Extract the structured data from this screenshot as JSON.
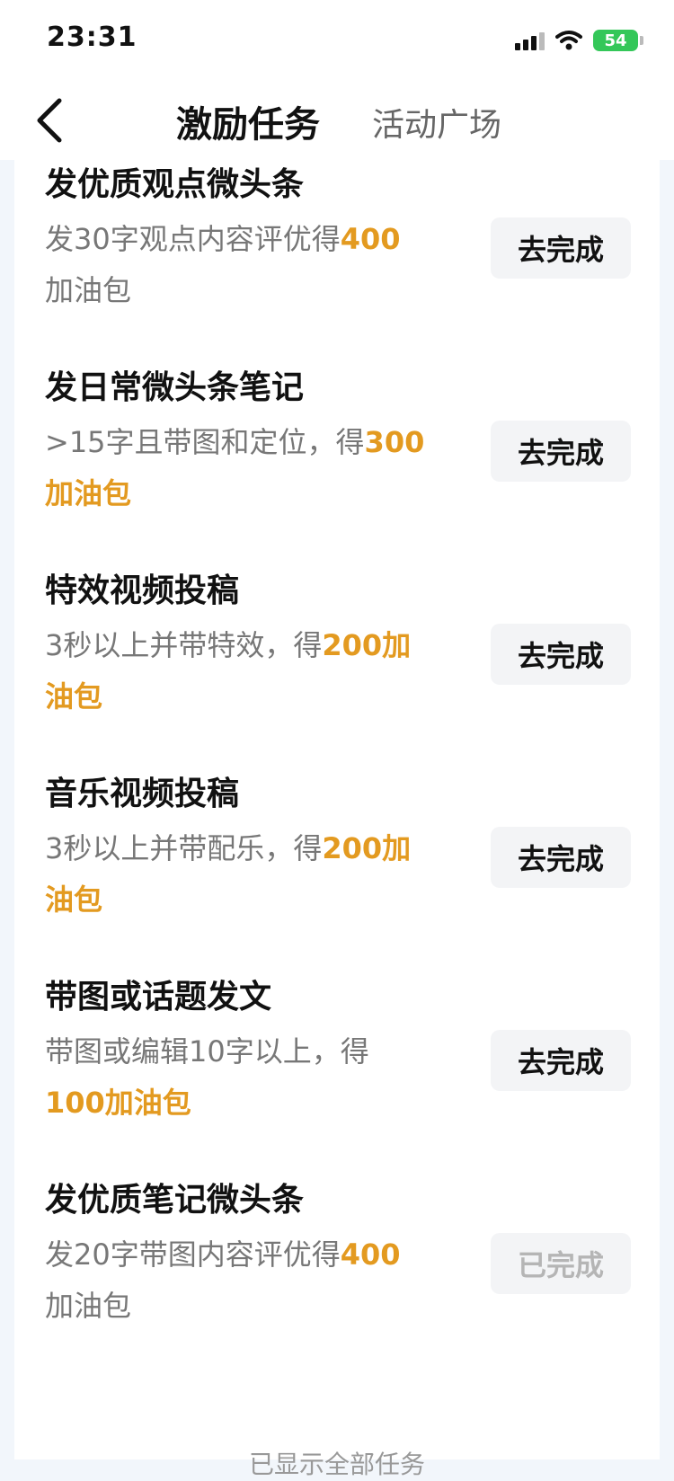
{
  "status_bar": {
    "time": "23:31",
    "battery": "54"
  },
  "header": {
    "active_tab": "激励任务",
    "other_tab": "活动广场"
  },
  "tasks": [
    {
      "title": "发优质观点微头条",
      "desc_lines": [
        [
          {
            "t": "发30字观点内容评优得"
          },
          {
            "t": "400",
            "hl": true
          }
        ],
        [
          {
            "t": "加油包"
          }
        ]
      ],
      "button": "去完成",
      "done": false
    },
    {
      "title": "发日常微头条笔记",
      "desc_lines": [
        [
          {
            "t": ">15字且带图和定位，得"
          },
          {
            "t": "300",
            "hl": true
          }
        ],
        [
          {
            "t": "加油包",
            "hl": true
          }
        ]
      ],
      "button": "去完成",
      "done": false
    },
    {
      "title": "特效视频投稿",
      "desc_lines": [
        [
          {
            "t": "3秒以上并带特效，得"
          },
          {
            "t": "200加",
            "hl": true
          }
        ],
        [
          {
            "t": "油包",
            "hl": true
          }
        ]
      ],
      "button": "去完成",
      "done": false
    },
    {
      "title": "音乐视频投稿",
      "desc_lines": [
        [
          {
            "t": "3秒以上并带配乐，得"
          },
          {
            "t": "200加",
            "hl": true
          }
        ],
        [
          {
            "t": "油包",
            "hl": true
          }
        ]
      ],
      "button": "去完成",
      "done": false
    },
    {
      "title": "带图或话题发文",
      "desc_lines": [
        [
          {
            "t": "带图或编辑10字以上，得"
          }
        ],
        [
          {
            "t": "100加油包",
            "hl": true
          }
        ]
      ],
      "button": "去完成",
      "done": false
    },
    {
      "title": "发优质笔记微头条",
      "desc_lines": [
        [
          {
            "t": "发20字带图内容评优得"
          },
          {
            "t": "400",
            "hl": true
          }
        ],
        [
          {
            "t": "加油包"
          }
        ]
      ],
      "button": "已完成",
      "done": true
    }
  ],
  "footer": "已显示全部任务",
  "colors": {
    "highlight": "#e39a20",
    "button_bg": "#f3f4f6",
    "done_text": "#b5b5b5"
  },
  "icons": {
    "back": "chevron-left-icon",
    "signal": "signal-icon",
    "wifi": "wifi-icon",
    "battery": "battery-icon"
  }
}
